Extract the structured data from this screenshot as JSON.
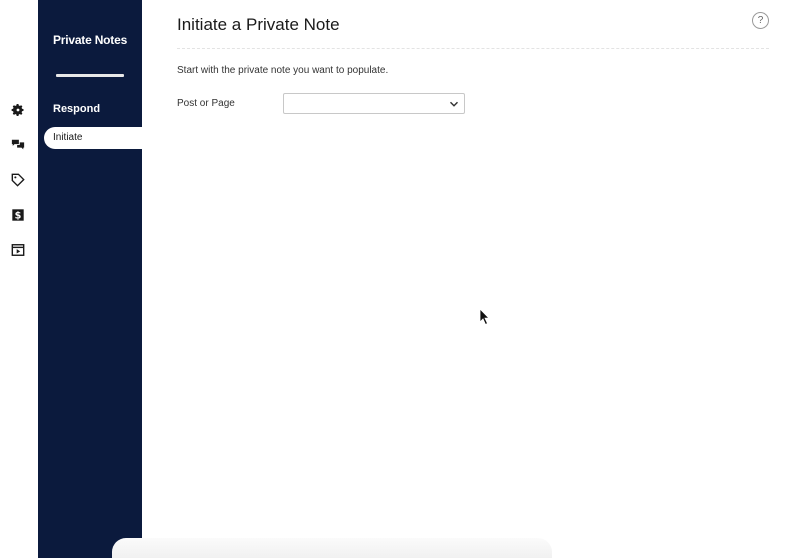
{
  "rail": {
    "icons": [
      "gear-icon",
      "chat-icon",
      "tag-icon",
      "dollar-icon",
      "play-box-icon"
    ]
  },
  "sidebar": {
    "title": "Private Notes",
    "section": "Respond",
    "active_item": "Initiate"
  },
  "main": {
    "title": "Initiate a Private Note",
    "help_label": "?",
    "intro": "Start with the private note you want to populate.",
    "field_label": "Post or Page",
    "select_value": ""
  },
  "colors": {
    "sidebar_bg": "#0b1a3d",
    "background": "#ffffff"
  }
}
